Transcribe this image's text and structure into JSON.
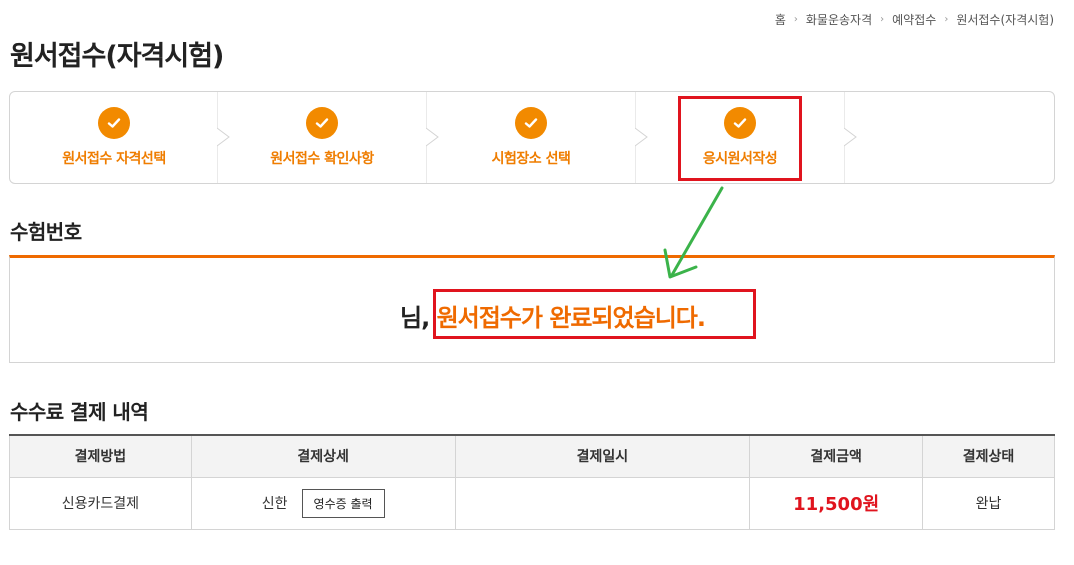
{
  "breadcrumb": {
    "items": [
      "홈",
      "화물운송자격",
      "예약접수",
      "원서접수(자격시험)"
    ]
  },
  "page_title": "원서접수(자격시험)",
  "steps": [
    {
      "label": "원서접수 자격선택",
      "icon": "check-icon"
    },
    {
      "label": "원서접수 확인사항",
      "icon": "check-icon"
    },
    {
      "label": "시험장소 선택",
      "icon": "check-icon"
    },
    {
      "label": "응시원서작성",
      "icon": "check-icon"
    }
  ],
  "exam_number": {
    "title": "수험번호",
    "name_suffix": "님,",
    "message": "원서접수가 완료되었습니다."
  },
  "payment": {
    "title": "수수료 결제 내역",
    "columns": [
      "결제방법",
      "결제상세",
      "결제일시",
      "결제금액",
      "결제상태"
    ],
    "row": {
      "method": "신용카드결제",
      "detail": "신한",
      "receipt_button": "영수증 출력",
      "datetime": "",
      "amount": "11,500원",
      "status": "완납"
    }
  },
  "colors": {
    "accent": "#ef7d00",
    "highlight": "#e0141e",
    "annotation_arrow": "#3bb34a"
  }
}
